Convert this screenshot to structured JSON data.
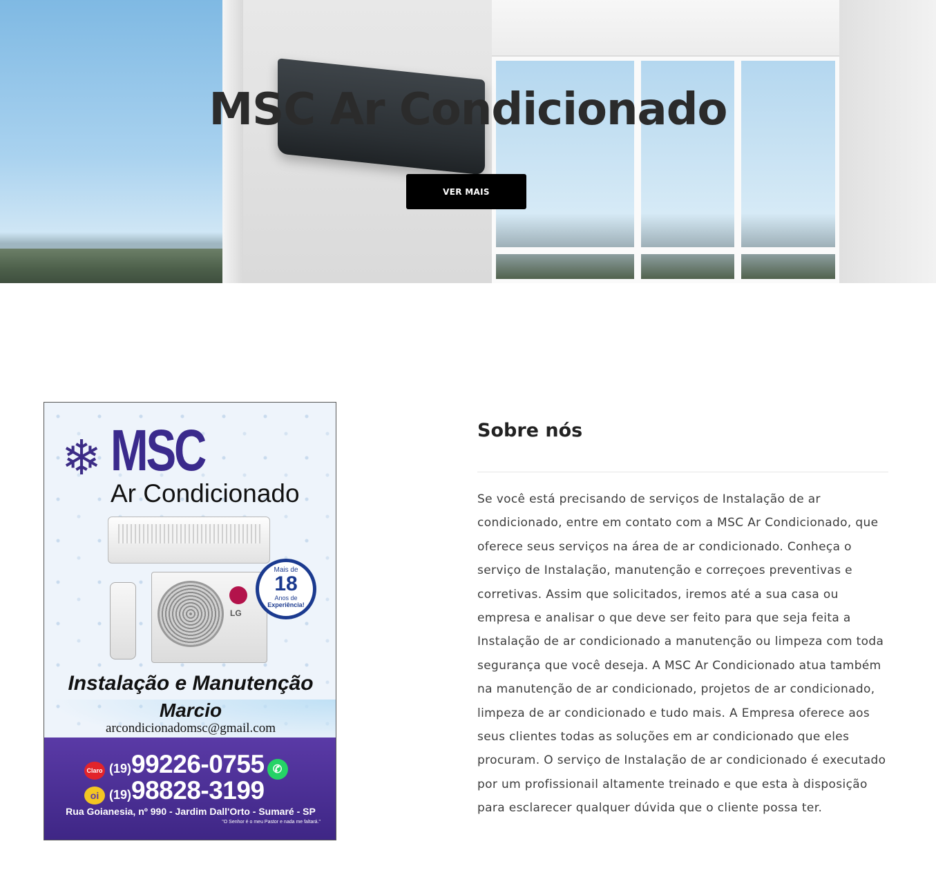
{
  "hero": {
    "title": "MSC Ar Condicionado",
    "button_label": "VER MAIS"
  },
  "flyer": {
    "brand": "MSC",
    "subtitle": "Ar Condicionado",
    "badge_top": "Mais de",
    "badge_number": "18",
    "badge_small": "Anos de",
    "badge_arc": "Experiência!",
    "lg_text": "LG",
    "headline": "Instalação e Manutenção",
    "name": "Marcio",
    "email": "arcondicionadomsc@gmail.com",
    "operator_1": "Claro",
    "ddd_1": "(19)",
    "phone_1": "99226-0755",
    "operator_2": "oi",
    "ddd_2": "(19)",
    "phone_2": "98828-3199",
    "address": "Rua Goianesia, nº 990 - Jardim Dall'Orto - Sumaré - SP",
    "quote": "\"O Senhor é o meu Pastor e nada me faltará.\""
  },
  "about": {
    "title": "Sobre nós",
    "text": "Se você está precisando de serviços de Instalação de ar condicionado, entre em contato com a MSC Ar Condicionado, que oferece seus serviços na área de ar condicionado. Conheça o serviço de Instalação, manutenção e correçoes preventivas e corretivas. Assim que solicitados, iremos até a sua casa ou empresa e analisar o que deve ser feito para que seja feita a Instalação de ar condicionado a manutenção ou limpeza com toda segurança que você deseja. A MSC Ar Condicionado atua também na manutenção de ar condicionado, projetos de ar condicionado, limpeza de ar condicionado e tudo mais. A Empresa oferece aos seus clientes todas as soluções em ar condicionado que eles procuram. O serviço de Instalação de ar condicionado é executado por um profissionail altamente treinado e que esta à disposição para esclarecer qualquer dúvida que o cliente possa ter."
  },
  "colors": {
    "button_bg": "#000000",
    "brand_purple": "#3a2a8c",
    "whatsapp_green": "#25d366"
  }
}
